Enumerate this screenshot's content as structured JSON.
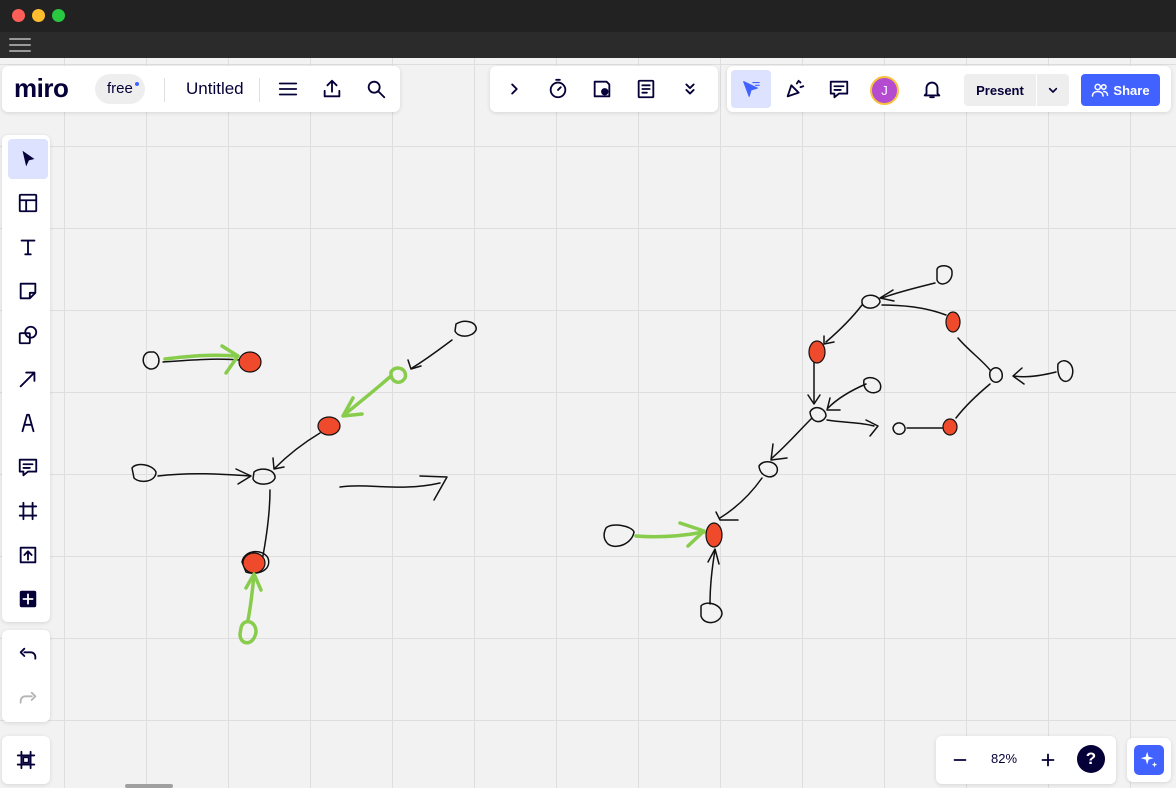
{
  "window": {
    "menu_icon": "hamburger-icon"
  },
  "topbar": {
    "logo": "miro",
    "plan_badge": "free",
    "board_title": "Untitled",
    "icons": [
      "menu-icon",
      "export-icon",
      "search-icon"
    ]
  },
  "collab_toolbar": {
    "icons": [
      "chevron-right-icon",
      "timer-icon",
      "voting-icon",
      "notes-icon",
      "chevron-double-down-icon"
    ]
  },
  "right_toolbar": {
    "icons": [
      "select-cursor-icon",
      "celebrate-icon",
      "comments-icon",
      "bell-icon"
    ],
    "avatar_initial": "J",
    "present_label": "Present",
    "share_label": "Share",
    "accent_color": "#4262ff"
  },
  "left_toolbar": {
    "tools": [
      "select-tool",
      "templates-tool",
      "text-tool",
      "sticky-note-tool",
      "shapes-tool",
      "arrow-tool",
      "pen-tool",
      "comment-tool",
      "frame-tool",
      "upload-tool",
      "more-apps-tool"
    ],
    "undo_icon": "undo-icon",
    "redo_icon": "redo-icon"
  },
  "bottom_left": {
    "icon": "frames-panel-icon"
  },
  "zoom": {
    "level": "82%",
    "minus_icon": "minus-icon",
    "plus_icon": "plus-icon",
    "help_label": "?"
  },
  "ai_assistant": {
    "icon": "sparkle-icon",
    "color": "#4262ff"
  },
  "canvas": {
    "ink_color": "#111111",
    "highlight_color": "#ee4a2b",
    "arrow_color": "#88cc4c"
  }
}
